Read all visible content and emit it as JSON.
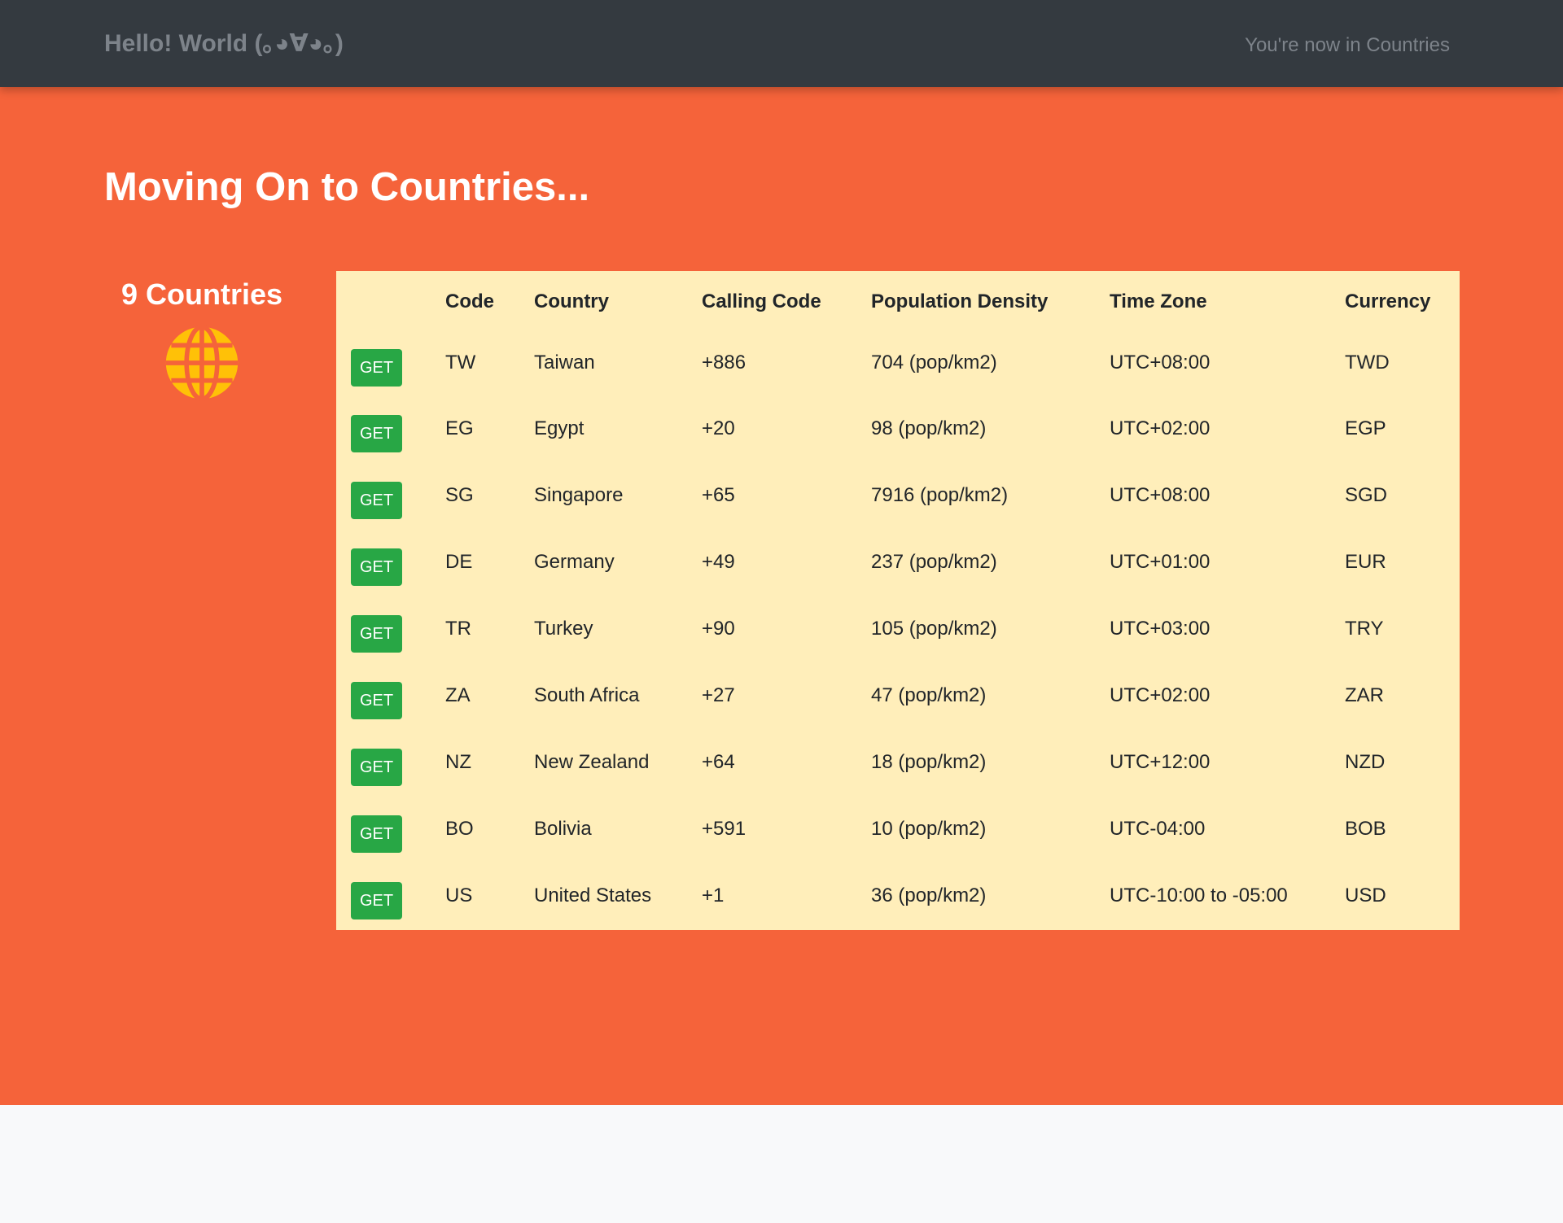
{
  "navbar": {
    "brand": "Hello! World (｡◕∀◕｡)",
    "status": "You're now in Countries"
  },
  "hero": {
    "title": "Moving On to Countries..."
  },
  "summary": {
    "count_label": "9 Countries",
    "icon": "globe-icon",
    "icon_color": "#ffc107"
  },
  "colors": {
    "navbar_bg": "#343a40",
    "hero_bg": "#f5633a",
    "table_bg": "#ffeeba",
    "button_bg": "#28a745"
  },
  "table": {
    "headers": [
      "",
      "Code",
      "Country",
      "Calling Code",
      "Population Density",
      "Time Zone",
      "Currency"
    ],
    "button_label": "GET",
    "rows": [
      {
        "code": "TW",
        "country": "Taiwan",
        "calling_code": "+886",
        "density": "704 (pop/km2)",
        "time_zone": "UTC+08:00",
        "currency": "TWD"
      },
      {
        "code": "EG",
        "country": "Egypt",
        "calling_code": "+20",
        "density": "98 (pop/km2)",
        "time_zone": "UTC+02:00",
        "currency": "EGP"
      },
      {
        "code": "SG",
        "country": "Singapore",
        "calling_code": "+65",
        "density": "7916 (pop/km2)",
        "time_zone": "UTC+08:00",
        "currency": "SGD"
      },
      {
        "code": "DE",
        "country": "Germany",
        "calling_code": "+49",
        "density": "237 (pop/km2)",
        "time_zone": "UTC+01:00",
        "currency": "EUR"
      },
      {
        "code": "TR",
        "country": "Turkey",
        "calling_code": "+90",
        "density": "105 (pop/km2)",
        "time_zone": "UTC+03:00",
        "currency": "TRY"
      },
      {
        "code": "ZA",
        "country": "South Africa",
        "calling_code": "+27",
        "density": "47 (pop/km2)",
        "time_zone": "UTC+02:00",
        "currency": "ZAR"
      },
      {
        "code": "NZ",
        "country": "New Zealand",
        "calling_code": "+64",
        "density": "18 (pop/km2)",
        "time_zone": "UTC+12:00",
        "currency": "NZD"
      },
      {
        "code": "BO",
        "country": "Bolivia",
        "calling_code": "+591",
        "density": "10 (pop/km2)",
        "time_zone": "UTC-04:00",
        "currency": "BOB"
      },
      {
        "code": "US",
        "country": "United States",
        "calling_code": "+1",
        "density": "36 (pop/km2)",
        "time_zone": "UTC-10:00 to -05:00",
        "currency": "USD"
      }
    ]
  }
}
